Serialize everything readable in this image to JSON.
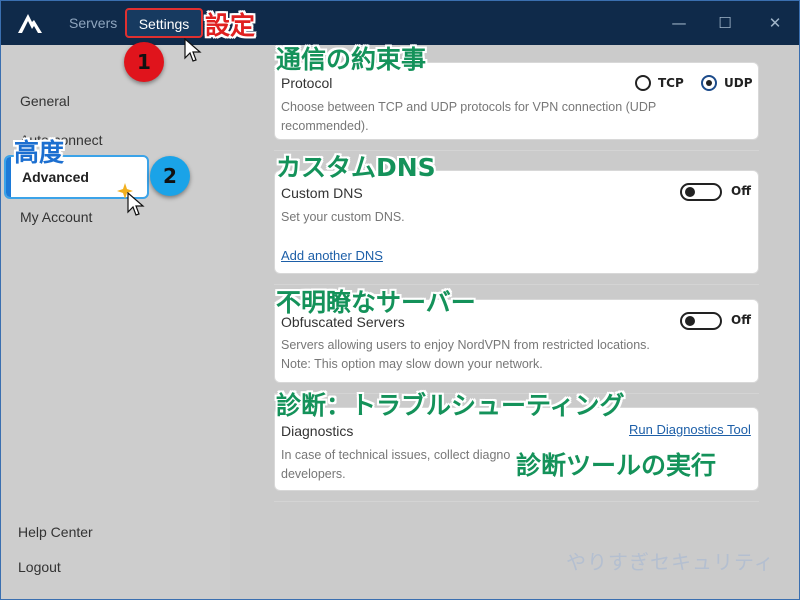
{
  "titlebar": {
    "nav_servers": "Servers",
    "nav_settings": "Settings",
    "minimize": "—",
    "maximize": "☐",
    "close": "✕"
  },
  "sidebar": {
    "items": [
      {
        "label": "General"
      },
      {
        "label": "Auto-connect"
      },
      {
        "label": "Advanced"
      },
      {
        "label": "My Account"
      }
    ],
    "help": "Help Center",
    "logout": "Logout"
  },
  "protocol": {
    "title": "Protocol",
    "description_line1": "Choose between TCP and UDP protocols for VPN connection (UDP",
    "description_line2": "recommended).",
    "tcp_label": "TCP",
    "udp_label": "UDP",
    "selected": "UDP"
  },
  "custom_dns": {
    "title": "Custom DNS",
    "description": "Set your custom DNS.",
    "toggle_label": "Off",
    "add_link": "Add another DNS"
  },
  "obfuscated": {
    "title": "Obfuscated Servers",
    "description_line1": "Servers allowing users to enjoy NordVPN from restricted locations.",
    "description_line2": "Note: This option may slow down your network.",
    "toggle_label": "Off"
  },
  "diagnostics": {
    "title": "Diagnostics",
    "link": "Run Diagnostics Tool",
    "description_line1": "In case of technical issues, collect diagno",
    "description_line2": "developers."
  },
  "annotations": {
    "settings_jp": "設定",
    "protocol_jp": "通信の約束事",
    "advanced_jp": "高度",
    "dns_jp": "カスタムDNS",
    "obfuscated_jp": "不明瞭なサーバー",
    "diagnostics_jp": "診断：トラブルシューティング",
    "run_tool_jp": "診断ツールの実行",
    "badge1": "1",
    "badge2": "2",
    "watermark": "やりすぎセキュリティ"
  },
  "colors": {
    "titlebar": "#0f2a4a",
    "sidebar": "#cdcdcd",
    "accent": "#1c7ad8",
    "annotation_green": "#14925a",
    "annotation_red": "#e02020",
    "annotation_blue": "#1c6fd0"
  }
}
